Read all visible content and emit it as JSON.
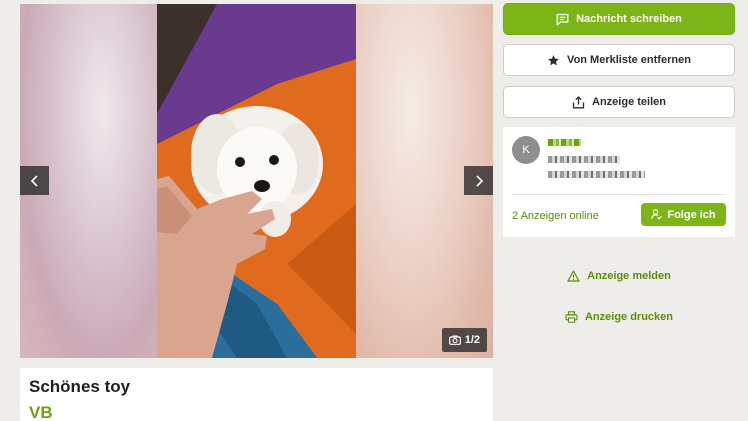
{
  "gallery": {
    "counter": "1/2",
    "prev_icon": "chevron-left-icon",
    "next_icon": "chevron-right-icon",
    "camera_icon": "camera-icon"
  },
  "listing": {
    "title": "Schönes toy",
    "price": "VB"
  },
  "actions": {
    "message_label": "Nachricht schreiben",
    "watchlist_label": "Von Merkliste entfernen",
    "share_label": "Anzeige teilen"
  },
  "seller": {
    "avatar_initial": "K",
    "ads_online": "2 Anzeigen online",
    "follow_label": "Folge ich"
  },
  "links": {
    "report_label": "Anzeige melden",
    "print_label": "Anzeige drucken"
  },
  "colors": {
    "accent": "#7cb518",
    "link": "#5a8d0c"
  }
}
